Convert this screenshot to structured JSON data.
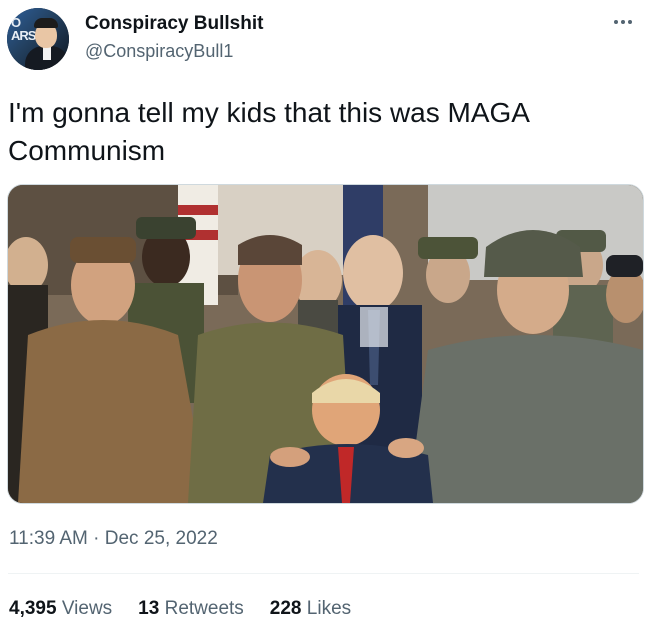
{
  "author": {
    "display_name": "Conspiracy Bullshit",
    "handle": "@ConspiracyBull1",
    "avatar_logo_text": "O\nARS"
  },
  "menu_icon": "more-horizontal-icon",
  "tweet": {
    "text": "I'm gonna tell my kids that this was MAGA\nCommunism",
    "time": "11:39 AM",
    "separator": "·",
    "date": "Dec 25, 2022"
  },
  "stats": {
    "views_count": "4,395",
    "views_label": "Views",
    "retweets_count": "13",
    "retweets_label": "Retweets",
    "likes_count": "228",
    "likes_label": "Likes"
  },
  "colors": {
    "text_primary": "#0f1419",
    "text_secondary": "#536471",
    "border": "#cfd9de"
  }
}
